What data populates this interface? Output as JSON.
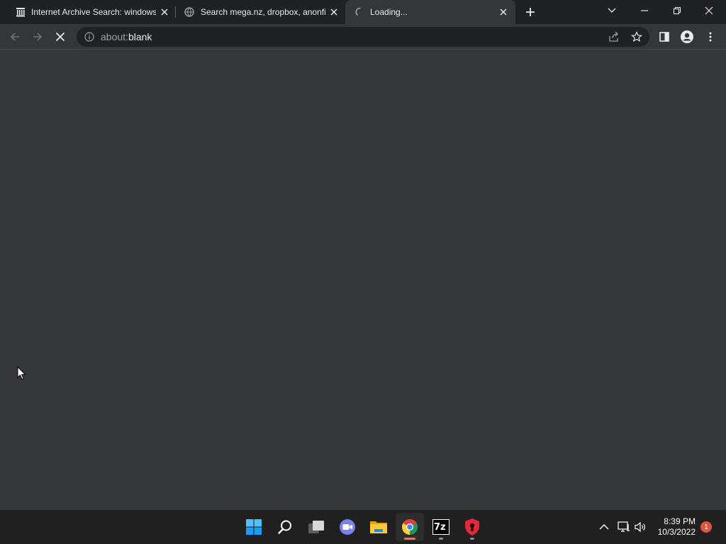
{
  "tabs": [
    {
      "title": "Internet Archive Search: windows",
      "favicon": "archive-icon"
    },
    {
      "title": "Search mega.nz, dropbox, anonfi",
      "favicon": "globe-icon"
    },
    {
      "title": "Loading...",
      "favicon": "loading-spinner-icon"
    }
  ],
  "omnibox": {
    "scheme": "about:",
    "host": "blank"
  },
  "clock": {
    "time": "8:39 PM",
    "date": "10/3/2022"
  },
  "notifications": {
    "count": "1"
  },
  "taskbar": {
    "apps": [
      "start-icon",
      "search-icon",
      "task-view-icon",
      "chat-icon",
      "file-explorer-icon",
      "chrome-icon",
      "7zip-icon",
      "security-icon"
    ],
    "seven_zip_label": "7z"
  },
  "colors": {
    "background": "#35363a",
    "tabstrip": "#202124",
    "taskbar": "#202020",
    "accent": "#ff6b5e"
  }
}
